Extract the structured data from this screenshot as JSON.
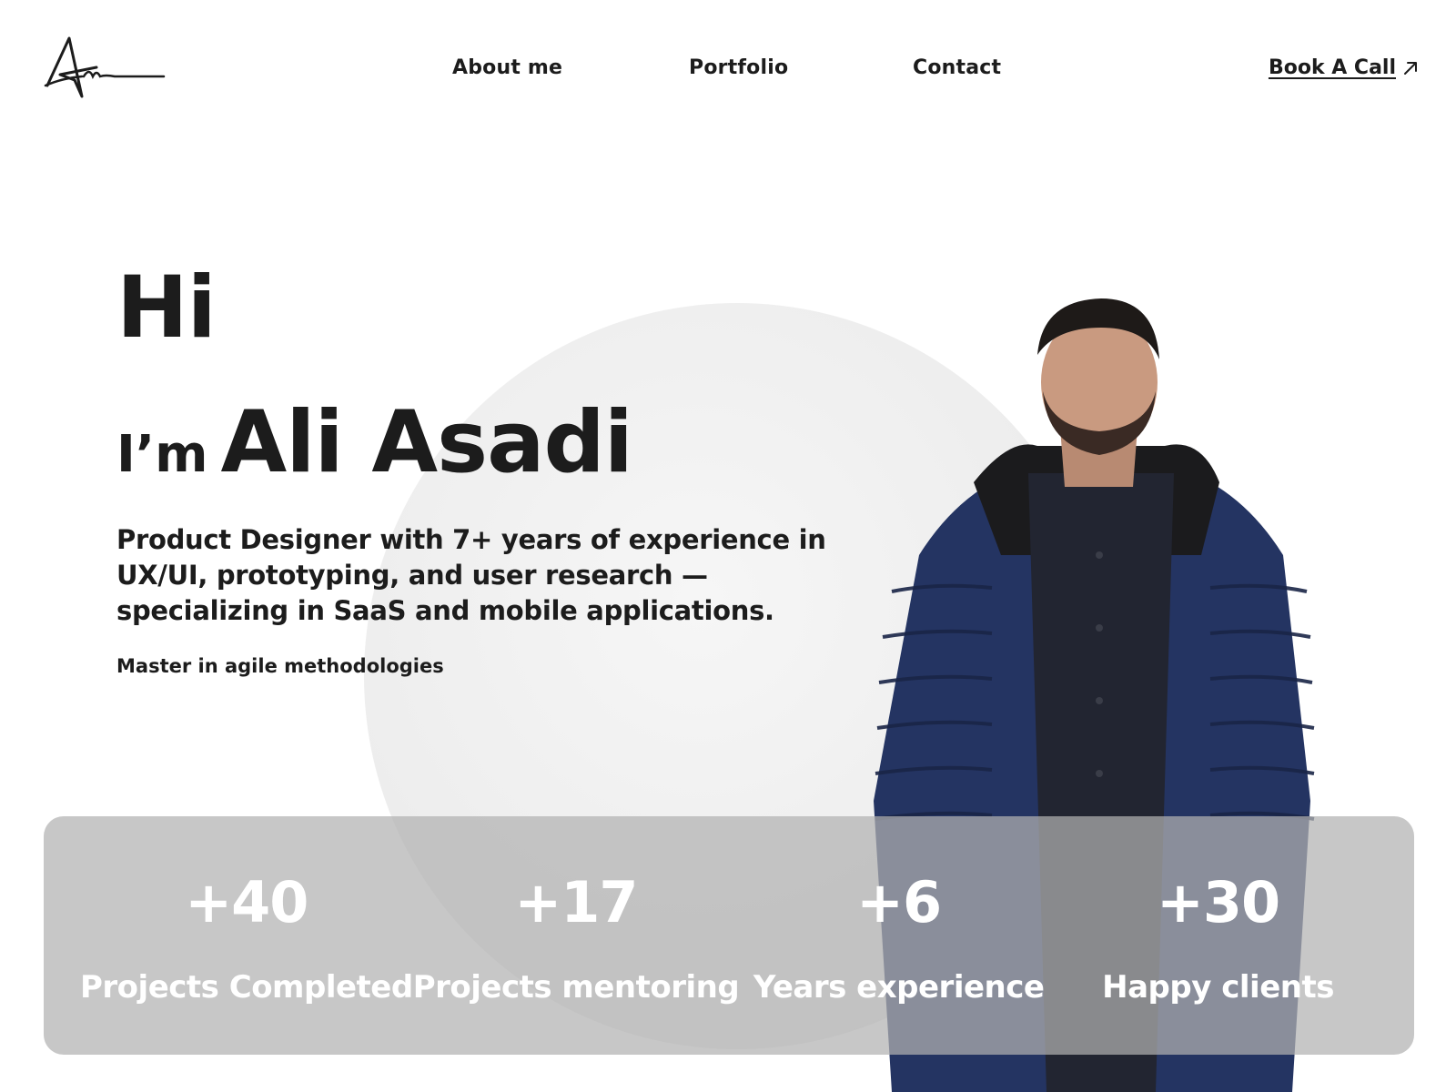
{
  "header": {
    "nav": {
      "about": "About me",
      "portfolio": "Portfolio",
      "contact": "Contact"
    },
    "cta": {
      "label": "Book A Call",
      "icon": "arrow-up-right-icon"
    },
    "logo_icon": "signature-logo"
  },
  "hero": {
    "greeting": "Hi",
    "intro_prefix": "I’m",
    "name": "Ali Asadi",
    "tagline": "Product Designer with 7+ years of experience in UX/UI, prototyping, and user research — specializing in SaaS and mobile applications.",
    "subtag": "Master in agile methodologies"
  },
  "stats": [
    {
      "value": "+40",
      "label": "Projects Completed"
    },
    {
      "value": "+17",
      "label": "Projects mentoring"
    },
    {
      "value": "+6",
      "label": "Years experience"
    },
    {
      "value": "+30",
      "label": "Happy clients"
    }
  ],
  "colors": {
    "text": "#1c1c1c",
    "stats_bg": "#c4c4c4",
    "stats_text": "#ffffff",
    "jacket": "#243462"
  }
}
